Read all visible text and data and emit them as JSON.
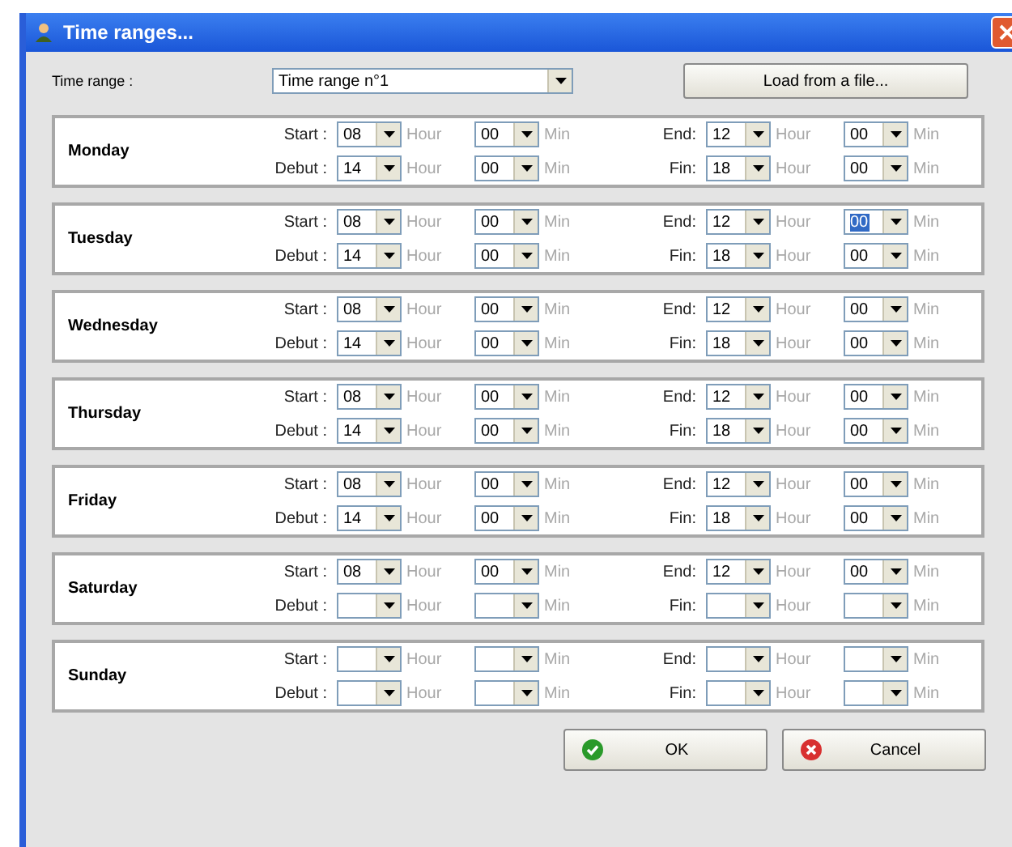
{
  "window": {
    "title": "Time ranges..."
  },
  "time_range": {
    "label": "Time range :",
    "value": "Time range n°1"
  },
  "load_button": "Load from a file...",
  "days": [
    {
      "name": "Monday",
      "rows": [
        {
          "label": "Start :",
          "end_label": "End:",
          "combos": [
            {
              "value": "08",
              "unit": "Hour",
              "selected": false
            },
            {
              "value": "00",
              "unit": "Min",
              "selected": false
            },
            {
              "value": "12",
              "unit": "Hour",
              "selected": false
            },
            {
              "value": "00",
              "unit": "Min",
              "selected": false
            }
          ]
        },
        {
          "label": "Debut :",
          "end_label": "Fin:",
          "combos": [
            {
              "value": "14",
              "unit": "Hour",
              "selected": false
            },
            {
              "value": "00",
              "unit": "Min",
              "selected": false
            },
            {
              "value": "18",
              "unit": "Hour",
              "selected": false
            },
            {
              "value": "00",
              "unit": "Min",
              "selected": false
            }
          ]
        }
      ]
    },
    {
      "name": "Tuesday",
      "rows": [
        {
          "label": "Start :",
          "end_label": "End:",
          "combos": [
            {
              "value": "08",
              "unit": "Hour",
              "selected": false
            },
            {
              "value": "00",
              "unit": "Min",
              "selected": false
            },
            {
              "value": "12",
              "unit": "Hour",
              "selected": false
            },
            {
              "value": "00",
              "unit": "Min",
              "selected": true
            }
          ]
        },
        {
          "label": "Debut :",
          "end_label": "Fin:",
          "combos": [
            {
              "value": "14",
              "unit": "Hour",
              "selected": false
            },
            {
              "value": "00",
              "unit": "Min",
              "selected": false
            },
            {
              "value": "18",
              "unit": "Hour",
              "selected": false
            },
            {
              "value": "00",
              "unit": "Min",
              "selected": false
            }
          ]
        }
      ]
    },
    {
      "name": "Wednesday",
      "rows": [
        {
          "label": "Start :",
          "end_label": "End:",
          "combos": [
            {
              "value": "08",
              "unit": "Hour",
              "selected": false
            },
            {
              "value": "00",
              "unit": "Min",
              "selected": false
            },
            {
              "value": "12",
              "unit": "Hour",
              "selected": false
            },
            {
              "value": "00",
              "unit": "Min",
              "selected": false
            }
          ]
        },
        {
          "label": "Debut :",
          "end_label": "Fin:",
          "combos": [
            {
              "value": "14",
              "unit": "Hour",
              "selected": false
            },
            {
              "value": "00",
              "unit": "Min",
              "selected": false
            },
            {
              "value": "18",
              "unit": "Hour",
              "selected": false
            },
            {
              "value": "00",
              "unit": "Min",
              "selected": false
            }
          ]
        }
      ]
    },
    {
      "name": "Thursday",
      "rows": [
        {
          "label": "Start :",
          "end_label": "End:",
          "combos": [
            {
              "value": "08",
              "unit": "Hour",
              "selected": false
            },
            {
              "value": "00",
              "unit": "Min",
              "selected": false
            },
            {
              "value": "12",
              "unit": "Hour",
              "selected": false
            },
            {
              "value": "00",
              "unit": "Min",
              "selected": false
            }
          ]
        },
        {
          "label": "Debut :",
          "end_label": "Fin:",
          "combos": [
            {
              "value": "14",
              "unit": "Hour",
              "selected": false
            },
            {
              "value": "00",
              "unit": "Min",
              "selected": false
            },
            {
              "value": "18",
              "unit": "Hour",
              "selected": false
            },
            {
              "value": "00",
              "unit": "Min",
              "selected": false
            }
          ]
        }
      ]
    },
    {
      "name": "Friday",
      "rows": [
        {
          "label": "Start :",
          "end_label": "End:",
          "combos": [
            {
              "value": "08",
              "unit": "Hour",
              "selected": false
            },
            {
              "value": "00",
              "unit": "Min",
              "selected": false
            },
            {
              "value": "12",
              "unit": "Hour",
              "selected": false
            },
            {
              "value": "00",
              "unit": "Min",
              "selected": false
            }
          ]
        },
        {
          "label": "Debut :",
          "end_label": "Fin:",
          "combos": [
            {
              "value": "14",
              "unit": "Hour",
              "selected": false
            },
            {
              "value": "00",
              "unit": "Min",
              "selected": false
            },
            {
              "value": "18",
              "unit": "Hour",
              "selected": false
            },
            {
              "value": "00",
              "unit": "Min",
              "selected": false
            }
          ]
        }
      ]
    },
    {
      "name": "Saturday",
      "rows": [
        {
          "label": "Start :",
          "end_label": "End:",
          "combos": [
            {
              "value": "08",
              "unit": "Hour",
              "selected": false
            },
            {
              "value": "00",
              "unit": "Min",
              "selected": false
            },
            {
              "value": "12",
              "unit": "Hour",
              "selected": false
            },
            {
              "value": "00",
              "unit": "Min",
              "selected": false
            }
          ]
        },
        {
          "label": "Debut :",
          "end_label": "Fin:",
          "combos": [
            {
              "unit": "Hour",
              "selected": false
            },
            {
              "unit": "Min",
              "selected": false
            },
            {
              "unit": "Hour",
              "selected": false
            },
            {
              "unit": "Min",
              "selected": false
            }
          ]
        }
      ]
    },
    {
      "name": "Sunday",
      "rows": [
        {
          "label": "Start :",
          "end_label": "End:",
          "combos": [
            {
              "unit": "Hour",
              "selected": false
            },
            {
              "unit": "Min",
              "selected": false
            },
            {
              "unit": "Hour",
              "selected": false
            },
            {
              "unit": "Min",
              "selected": false
            }
          ]
        },
        {
          "label": "Debut :",
          "end_label": "Fin:",
          "combos": [
            {
              "unit": "Hour",
              "selected": false
            },
            {
              "unit": "Min",
              "selected": false
            },
            {
              "unit": "Hour",
              "selected": false
            },
            {
              "unit": "Min",
              "selected": false
            }
          ]
        }
      ]
    }
  ],
  "buttons": {
    "ok": "OK",
    "cancel": "Cancel"
  }
}
